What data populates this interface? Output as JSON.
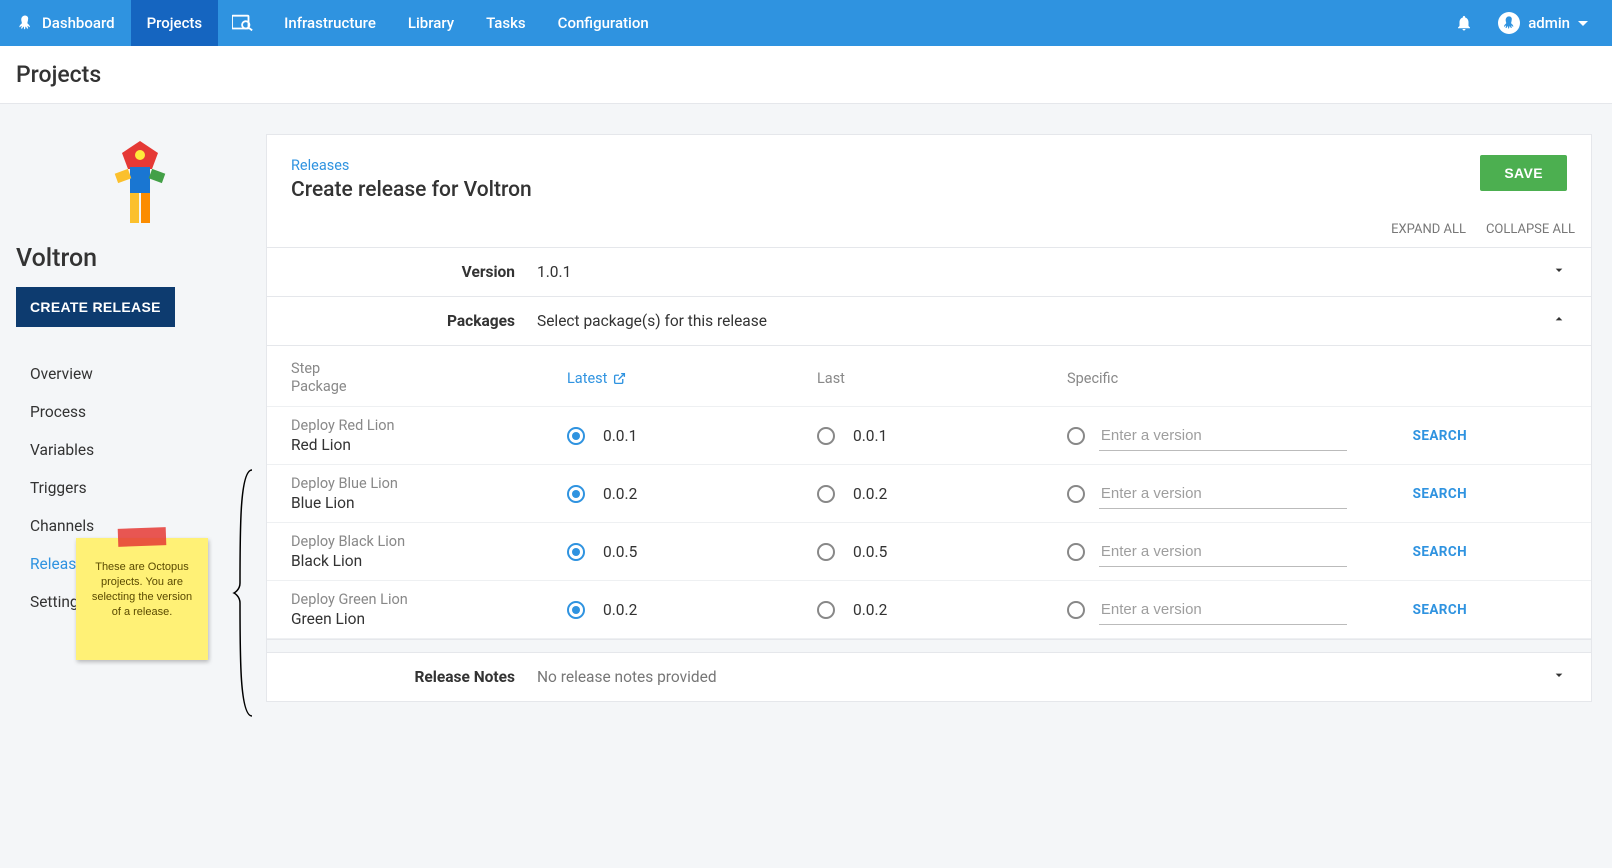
{
  "topnav": {
    "items": [
      "Dashboard",
      "Projects",
      "",
      "Infrastructure",
      "Library",
      "Tasks",
      "Configuration"
    ],
    "active_index": 1,
    "user_label": "admin"
  },
  "page": {
    "title": "Projects"
  },
  "sidebar": {
    "project_name": "Voltron",
    "create_release_label": "CREATE RELEASE",
    "items": [
      {
        "label": "Overview"
      },
      {
        "label": "Process"
      },
      {
        "label": "Variables"
      },
      {
        "label": "Triggers"
      },
      {
        "label": "Channels"
      },
      {
        "label": "Releases"
      },
      {
        "label": "Settings"
      }
    ],
    "active_index": 5
  },
  "sticky_note": {
    "text": "These are Octopus projects.  You are selecting the version of a release."
  },
  "card": {
    "breadcrumb": "Releases",
    "title": "Create release for Voltron",
    "save_label": "SAVE",
    "expand_all": "EXPAND ALL",
    "collapse_all": "COLLAPSE ALL"
  },
  "version_section": {
    "label": "Version",
    "value": "1.0.1"
  },
  "packages_section": {
    "label": "Packages",
    "hint": "Select package(s) for this release",
    "columns": {
      "step": "Step",
      "package": "Package",
      "latest": "Latest",
      "last": "Last",
      "specific": "Specific"
    },
    "specific_placeholder": "Enter a version",
    "search_label": "SEARCH",
    "rows": [
      {
        "step": "Deploy Red Lion",
        "package": "Red Lion",
        "latest": "0.0.1",
        "last": "0.0.1"
      },
      {
        "step": "Deploy Blue Lion",
        "package": "Blue Lion",
        "latest": "0.0.2",
        "last": "0.0.2"
      },
      {
        "step": "Deploy Black Lion",
        "package": "Black Lion",
        "latest": "0.0.5",
        "last": "0.0.5"
      },
      {
        "step": "Deploy Green Lion",
        "package": "Green Lion",
        "latest": "0.0.2",
        "last": "0.0.2"
      }
    ]
  },
  "release_notes": {
    "label": "Release Notes",
    "hint": "No release notes provided"
  }
}
